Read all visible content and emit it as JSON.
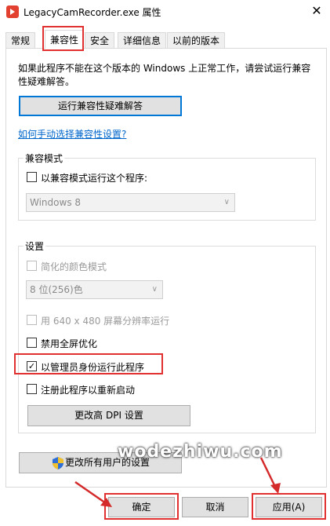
{
  "window": {
    "title": "LegacyCamRecorder.exe 属性",
    "close_glyph": "✕"
  },
  "tabs": [
    {
      "label": "常规"
    },
    {
      "label": "兼容性"
    },
    {
      "label": "安全"
    },
    {
      "label": "详细信息"
    },
    {
      "label": "以前的版本"
    }
  ],
  "compat": {
    "description": "如果此程序不能在这个版本的 Windows 上正常工作，请尝试运行兼容性疑难解答。",
    "troubleshoot_button": "运行兼容性疑难解答",
    "manual_link": "如何手动选择兼容性设置?"
  },
  "compat_mode": {
    "group_label": "兼容模式",
    "checkbox_label": "以兼容模式运行这个程序:",
    "checked": false,
    "os_select": "Windows 8"
  },
  "settings": {
    "group_label": "设置",
    "reduced_color_label": "简化的颜色模式",
    "color_select": "8 位(256)色",
    "res_640_label": "用 640 x 480 屏幕分辨率运行",
    "disable_fullscreen_label": "禁用全屏优化",
    "run_as_admin_label": "以管理员身份运行此程序",
    "run_as_admin_checked": true,
    "register_restart_label": "注册此程序以重新启动",
    "change_dpi_button": "更改高 DPI 设置"
  },
  "all_users_button": "更改所有用户的设置",
  "footer": {
    "ok": "确定",
    "cancel": "取消",
    "apply": "应用(A)"
  },
  "watermark": "wodezhiwu.com",
  "colors": {
    "highlight_red": "#e03030",
    "link_blue": "#0066cc",
    "focus_blue": "#0078d7"
  }
}
